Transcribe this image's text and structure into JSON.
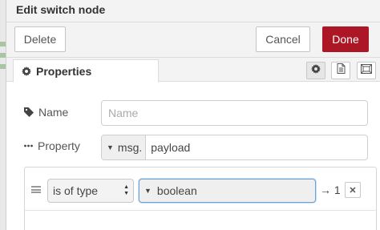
{
  "dialog": {
    "title": "Edit switch node"
  },
  "toolbar": {
    "delete_label": "Delete",
    "cancel_label": "Cancel",
    "done_label": "Done"
  },
  "colors": {
    "done_bg": "#ad1625",
    "focus_border": "#69a3d8"
  },
  "tabs": {
    "properties_label": "Properties",
    "properties_icon": "gear-icon",
    "side_icons": [
      "gear-icon",
      "description-icon",
      "appearance-icon"
    ]
  },
  "form": {
    "name": {
      "label": "Name",
      "icon": "tag-icon",
      "placeholder": "Name",
      "value": ""
    },
    "property": {
      "label": "Property",
      "icon": "ellipsis-icon",
      "type": "msg.",
      "value": "payload"
    }
  },
  "rules": [
    {
      "operator": "is of type",
      "value_type": "boolean",
      "output_arrow": "→",
      "output": "1",
      "remove_icon": "close-icon"
    }
  ]
}
